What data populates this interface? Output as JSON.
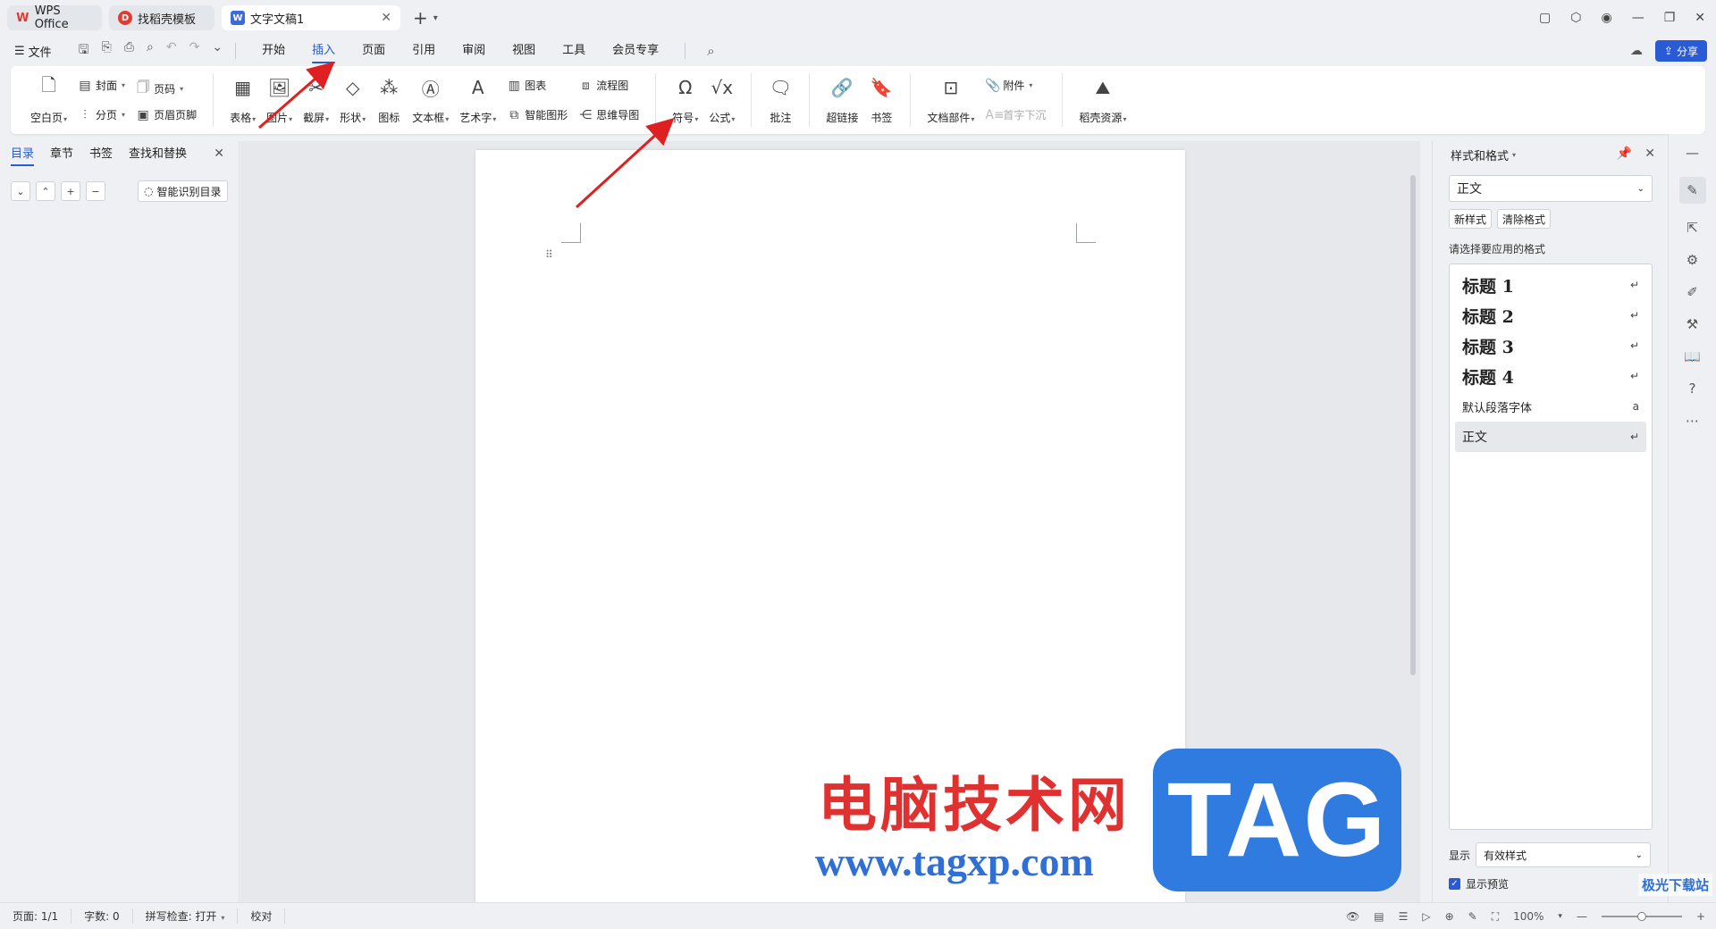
{
  "titlebar": {
    "tabs": [
      {
        "label": "WPS Office"
      },
      {
        "label": "找稻壳模板"
      },
      {
        "label": "文字文稿1"
      }
    ]
  },
  "menubar": {
    "file_label": "文件",
    "tabs": [
      "开始",
      "插入",
      "页面",
      "引用",
      "审阅",
      "视图",
      "工具",
      "会员专享"
    ],
    "active_tab": "插入",
    "share_label": "分享"
  },
  "ribbon": {
    "blank_page": "空白页",
    "cover": "封面",
    "page_break": "分页",
    "page_number": "页码",
    "header_footer": "页眉页脚",
    "table": "表格",
    "picture": "图片",
    "screenshot": "截屏",
    "shape": "形状",
    "icon": "图标",
    "textbox": "文本框",
    "wordart": "艺术字",
    "chart": "图表",
    "smart_graphic": "智能图形",
    "flowchart": "流程图",
    "mindmap": "思维导图",
    "symbol": "符号",
    "formula": "公式",
    "comment": "批注",
    "hyperlink": "超链接",
    "bookmark": "书签",
    "doc_parts": "文档部件",
    "attachment": "附件",
    "drop_cap": "首字下沉",
    "daoke_resources": "稻壳资源"
  },
  "leftpane": {
    "tabs": [
      "目录",
      "章节",
      "书签",
      "查找和替换"
    ],
    "active_tab": "目录",
    "smart_toc_label": "智能识别目录"
  },
  "rightpane": {
    "title": "样式和格式",
    "current_style": "正文",
    "new_style_label": "新样式",
    "clear_format_label": "清除格式",
    "hint": "请选择要应用的格式",
    "styles": [
      {
        "name": "标题  1",
        "mark": "↵"
      },
      {
        "name": "标题  2",
        "mark": "↵"
      },
      {
        "name": "标题  3",
        "mark": "↵"
      },
      {
        "name": "标题  4",
        "mark": "↵"
      },
      {
        "name": "默认段落字体",
        "mark": "a"
      },
      {
        "name": "正文",
        "mark": "↵"
      }
    ],
    "selected_style": "正文",
    "show_label": "显示",
    "show_value": "有效样式",
    "preview_label": "显示预览"
  },
  "statusbar": {
    "page": "页面: 1/1",
    "words": "字数: 0",
    "spellcheck": "拼写检查: 打开",
    "proofread": "校对",
    "zoom": "100%",
    "zoom_level": 0.5
  },
  "watermark": {
    "cn_text": "电脑技术网",
    "url": "www.tagxp.com",
    "tag": "TAG",
    "corner": "极光下载站"
  },
  "colors": {
    "accent": "#2a5bd7",
    "arrow": "#e02020",
    "watermark_red": "#e03131",
    "watermark_blue": "#2f7be0"
  }
}
